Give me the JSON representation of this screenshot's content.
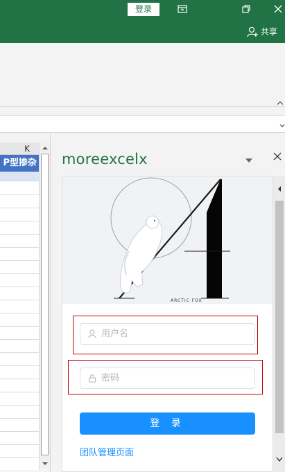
{
  "titlebar": {
    "login_label": "登录",
    "share_label": "共享",
    "icons": [
      "ribbon-display-icon",
      "restore-icon",
      "close-icon",
      "share-person-icon"
    ]
  },
  "grid": {
    "column_letter": "K",
    "header_cell_text": "P型掺杂"
  },
  "taskpane": {
    "title": "moreexcelx",
    "hero_caption": "ARCTIC FOX",
    "username_placeholder": "用户名",
    "password_placeholder": "密码",
    "submit_label": "登 录",
    "admin_link_label": "团队管理页面"
  },
  "colors": {
    "excel_green": "#217346",
    "header_blue": "#4472c4",
    "primary_blue": "#1890ff",
    "highlight_red": "#c00000"
  }
}
